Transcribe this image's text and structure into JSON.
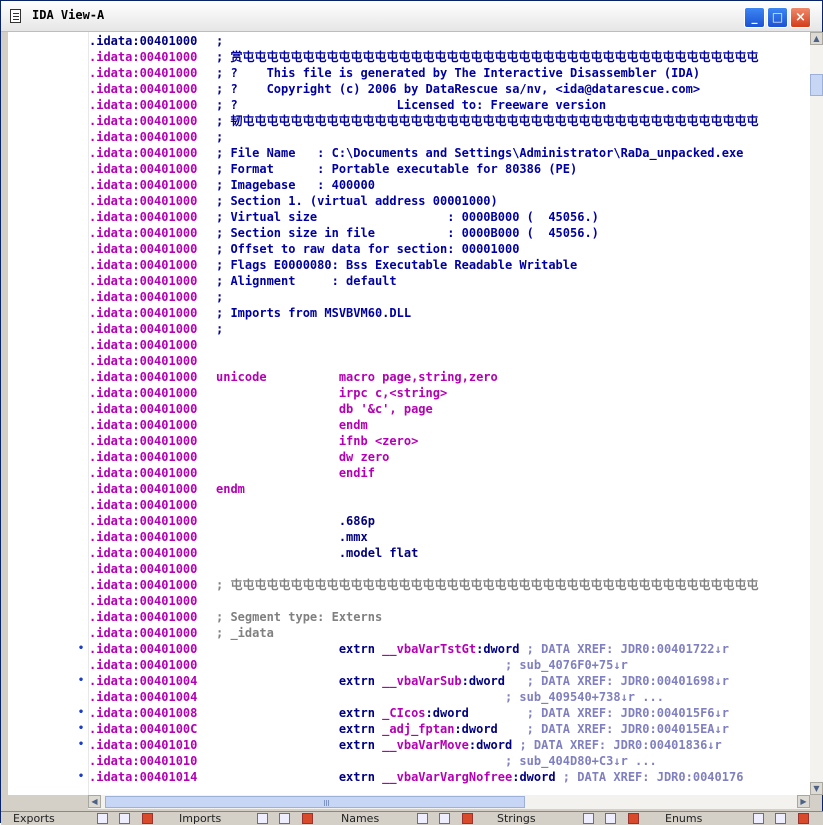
{
  "window": {
    "title": "IDA View-A",
    "buttons": {
      "minimize": "_",
      "maximize": "□",
      "close": "×"
    }
  },
  "listing": [
    {
      "addr": ".idata:00401000",
      "parts": [
        {
          "t": ";",
          "c": "blue"
        }
      ],
      "first": true
    },
    {
      "addr": ".idata:00401000",
      "parts": [
        {
          "t": "; 赏屯屯屯屯屯屯屯屯屯屯屯屯屯屯屯屯屯屯屯屯屯屯屯屯屯屯屯屯屯屯屯屯屯屯屯屯屯屯屯屯屯屯屯",
          "c": "cmt"
        }
      ]
    },
    {
      "addr": ".idata:00401000",
      "parts": [
        {
          "t": "; ?    This file is generated by The Interactive Disassembler (IDA)",
          "c": "cmt"
        }
      ]
    },
    {
      "addr": ".idata:00401000",
      "parts": [
        {
          "t": "; ?    Copyright (c) 2006 by DataRescue sa/nv, <ida@datarescue.com>",
          "c": "cmt"
        }
      ]
    },
    {
      "addr": ".idata:00401000",
      "parts": [
        {
          "t": "; ?                      Licensed to: Freeware version",
          "c": "cmt"
        }
      ]
    },
    {
      "addr": ".idata:00401000",
      "parts": [
        {
          "t": "; 韧屯屯屯屯屯屯屯屯屯屯屯屯屯屯屯屯屯屯屯屯屯屯屯屯屯屯屯屯屯屯屯屯屯屯屯屯屯屯屯屯屯屯屯",
          "c": "cmt"
        }
      ]
    },
    {
      "addr": ".idata:00401000",
      "parts": [
        {
          "t": ";",
          "c": "cmt"
        }
      ]
    },
    {
      "addr": ".idata:00401000",
      "parts": [
        {
          "t": "; File Name   : C:\\Documents and Settings\\Administrator\\RaDa_unpacked.exe",
          "c": "cmt"
        }
      ]
    },
    {
      "addr": ".idata:00401000",
      "parts": [
        {
          "t": "; Format      : Portable executable for 80386 (PE)",
          "c": "cmt"
        }
      ]
    },
    {
      "addr": ".idata:00401000",
      "parts": [
        {
          "t": "; Imagebase   : 400000",
          "c": "cmt"
        }
      ]
    },
    {
      "addr": ".idata:00401000",
      "parts": [
        {
          "t": "; Section 1. (virtual address 00001000)",
          "c": "cmt"
        }
      ]
    },
    {
      "addr": ".idata:00401000",
      "parts": [
        {
          "t": "; Virtual size                  : 0000B000 (  45056.)",
          "c": "cmt"
        }
      ]
    },
    {
      "addr": ".idata:00401000",
      "parts": [
        {
          "t": "; Section size in file          : 0000B000 (  45056.)",
          "c": "cmt"
        }
      ]
    },
    {
      "addr": ".idata:00401000",
      "parts": [
        {
          "t": "; Offset to raw data for section: 00001000",
          "c": "cmt"
        }
      ]
    },
    {
      "addr": ".idata:00401000",
      "parts": [
        {
          "t": "; Flags E0000080: Bss Executable Readable Writable",
          "c": "cmt"
        }
      ]
    },
    {
      "addr": ".idata:00401000",
      "parts": [
        {
          "t": "; Alignment     : default",
          "c": "cmt"
        }
      ]
    },
    {
      "addr": ".idata:00401000",
      "parts": [
        {
          "t": ";",
          "c": "cmt"
        }
      ]
    },
    {
      "addr": ".idata:00401000",
      "parts": [
        {
          "t": "; Imports from MSVBVM60.DLL",
          "c": "cmt"
        }
      ]
    },
    {
      "addr": ".idata:00401000",
      "parts": [
        {
          "t": ";",
          "c": "cmt"
        }
      ]
    },
    {
      "addr": ".idata:00401000",
      "parts": []
    },
    {
      "addr": ".idata:00401000",
      "parts": []
    },
    {
      "addr": ".idata:00401000",
      "parts": [
        {
          "t": "unicode          macro page,string,zero",
          "c": "mag"
        }
      ]
    },
    {
      "addr": ".idata:00401000",
      "parts": [
        {
          "t": "                 irpc c,<string>",
          "c": "mag"
        }
      ]
    },
    {
      "addr": ".idata:00401000",
      "parts": [
        {
          "t": "                 db '&c', page",
          "c": "mag"
        }
      ]
    },
    {
      "addr": ".idata:00401000",
      "parts": [
        {
          "t": "                 endm",
          "c": "mag"
        }
      ]
    },
    {
      "addr": ".idata:00401000",
      "parts": [
        {
          "t": "                 ifnb <zero>",
          "c": "mag"
        }
      ]
    },
    {
      "addr": ".idata:00401000",
      "parts": [
        {
          "t": "                 dw zero",
          "c": "mag"
        }
      ]
    },
    {
      "addr": ".idata:00401000",
      "parts": [
        {
          "t": "                 endif",
          "c": "mag"
        }
      ]
    },
    {
      "addr": ".idata:00401000",
      "parts": [
        {
          "t": "endm",
          "c": "mag"
        }
      ]
    },
    {
      "addr": ".idata:00401000",
      "parts": []
    },
    {
      "addr": ".idata:00401000",
      "parts": [
        {
          "t": "                 .686p",
          "c": "blue"
        }
      ]
    },
    {
      "addr": ".idata:00401000",
      "parts": [
        {
          "t": "                 .mmx",
          "c": "blue"
        }
      ]
    },
    {
      "addr": ".idata:00401000",
      "parts": [
        {
          "t": "                 .model flat",
          "c": "blue"
        }
      ]
    },
    {
      "addr": ".idata:00401000",
      "parts": []
    },
    {
      "addr": ".idata:00401000",
      "parts": [
        {
          "t": "; 屯屯屯屯屯屯屯屯屯屯屯屯屯屯屯屯屯屯屯屯屯屯屯屯屯屯屯屯屯屯屯屯屯屯屯屯屯屯屯屯屯屯屯屯",
          "c": "gray"
        }
      ]
    },
    {
      "addr": ".idata:00401000",
      "parts": []
    },
    {
      "addr": ".idata:00401000",
      "parts": [
        {
          "t": "; Segment type: Externs",
          "c": "gray"
        }
      ]
    },
    {
      "addr": ".idata:00401000",
      "parts": [
        {
          "t": "; _idata",
          "c": "gray"
        }
      ]
    },
    {
      "addr": ".idata:00401000",
      "bullet": true,
      "parts": [
        {
          "t": "                 extrn ",
          "c": "blue"
        },
        {
          "t": "__vbaVarTstGt",
          "c": "mag"
        },
        {
          "t": ":dword ",
          "c": "blue"
        },
        {
          "t": "; DATA XREF: JDR0:00401722↓r",
          "c": "xref"
        }
      ]
    },
    {
      "addr": ".idata:00401000",
      "parts": [
        {
          "t": "                                        ; sub_4076F0+75↓r",
          "c": "xref"
        }
      ]
    },
    {
      "addr": ".idata:00401004",
      "bullet": true,
      "parts": [
        {
          "t": "                 extrn ",
          "c": "blue"
        },
        {
          "t": "__vbaVarSub",
          "c": "mag"
        },
        {
          "t": ":dword   ",
          "c": "blue"
        },
        {
          "t": "; DATA XREF: JDR0:00401698↓r",
          "c": "xref"
        }
      ]
    },
    {
      "addr": ".idata:00401004",
      "parts": [
        {
          "t": "                                        ; sub_409540+738↓r ...",
          "c": "xref"
        }
      ]
    },
    {
      "addr": ".idata:00401008",
      "bullet": true,
      "parts": [
        {
          "t": "                 extrn ",
          "c": "blue"
        },
        {
          "t": "_CIcos",
          "c": "mag"
        },
        {
          "t": ":dword        ",
          "c": "blue"
        },
        {
          "t": "; DATA XREF: JDR0:004015F6↓r",
          "c": "xref"
        }
      ]
    },
    {
      "addr": ".idata:0040100C",
      "bullet": true,
      "parts": [
        {
          "t": "                 extrn ",
          "c": "blue"
        },
        {
          "t": "_adj_fptan",
          "c": "mag"
        },
        {
          "t": ":dword    ",
          "c": "blue"
        },
        {
          "t": "; DATA XREF: JDR0:004015EA↓r",
          "c": "xref"
        }
      ]
    },
    {
      "addr": ".idata:00401010",
      "bullet": true,
      "parts": [
        {
          "t": "                 extrn ",
          "c": "blue"
        },
        {
          "t": "__vbaVarMove",
          "c": "mag"
        },
        {
          "t": ":dword ",
          "c": "blue"
        },
        {
          "t": "; DATA XREF: JDR0:00401836↓r",
          "c": "xref"
        }
      ]
    },
    {
      "addr": ".idata:00401010",
      "parts": [
        {
          "t": "                                        ; sub_404D80+C3↓r ...",
          "c": "xref"
        }
      ]
    },
    {
      "addr": ".idata:00401014",
      "bullet": true,
      "parts": [
        {
          "t": "                 extrn ",
          "c": "blue"
        },
        {
          "t": "__vbaVarVargNofree",
          "c": "mag"
        },
        {
          "t": ":dword ",
          "c": "blue"
        },
        {
          "t": "; DATA XREF: JDR0:0040176",
          "c": "xref"
        }
      ]
    }
  ],
  "taskbar": {
    "items": [
      "Exports",
      "Imports",
      "Names",
      "Strings",
      "Enums"
    ]
  }
}
